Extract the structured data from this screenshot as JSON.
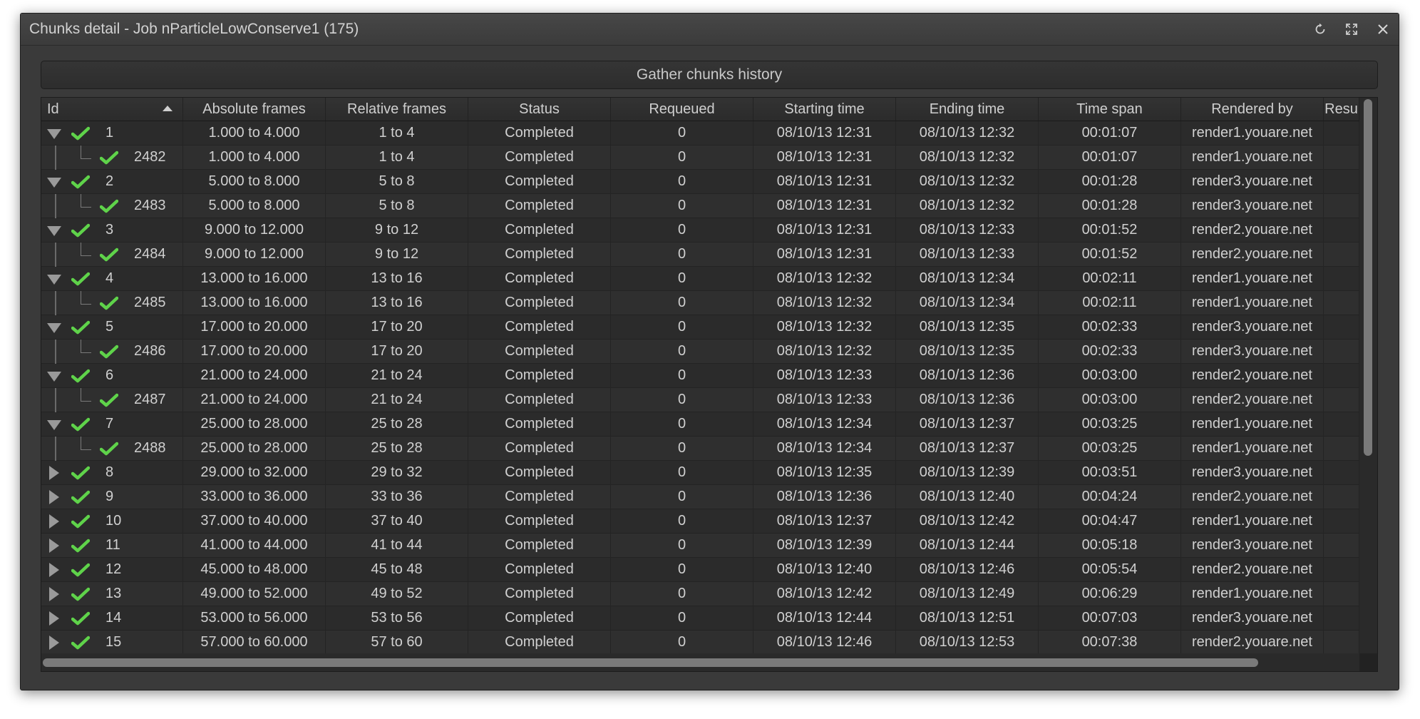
{
  "window": {
    "title": "Chunks detail - Job nParticleLowConserve1 (175)"
  },
  "toolbar": {
    "gather_label": "Gather chunks history"
  },
  "table": {
    "columns": [
      {
        "key": "id",
        "label": "Id",
        "width": 199
      },
      {
        "key": "abs",
        "label": "Absolute frames",
        "width": 200
      },
      {
        "key": "rel",
        "label": "Relative frames",
        "width": 200
      },
      {
        "key": "status",
        "label": "Status",
        "width": 200
      },
      {
        "key": "requeued",
        "label": "Requeued",
        "width": 200
      },
      {
        "key": "start",
        "label": "Starting time",
        "width": 200
      },
      {
        "key": "end",
        "label": "Ending time",
        "width": 200
      },
      {
        "key": "span",
        "label": "Time span",
        "width": 200
      },
      {
        "key": "by",
        "label": "Rendered by",
        "width": 200
      },
      {
        "key": "res",
        "label": "Resu",
        "width": 50
      }
    ],
    "sorted_column": "id",
    "rows": [
      {
        "level": 0,
        "expanded": true,
        "id": "1",
        "abs": "1.000 to 4.000",
        "rel": "1 to 4",
        "status": "Completed",
        "requeued": "0",
        "start": "08/10/13 12:31",
        "end": "08/10/13 12:32",
        "span": "00:01:07",
        "by": "render1.youare.net"
      },
      {
        "level": 1,
        "id": "2482",
        "abs": "1.000 to 4.000",
        "rel": "1 to 4",
        "status": "Completed",
        "requeued": "0",
        "start": "08/10/13 12:31",
        "end": "08/10/13 12:32",
        "span": "00:01:07",
        "by": "render1.youare.net"
      },
      {
        "level": 0,
        "expanded": true,
        "id": "2",
        "abs": "5.000 to 8.000",
        "rel": "5 to 8",
        "status": "Completed",
        "requeued": "0",
        "start": "08/10/13 12:31",
        "end": "08/10/13 12:32",
        "span": "00:01:28",
        "by": "render3.youare.net"
      },
      {
        "level": 1,
        "id": "2483",
        "abs": "5.000 to 8.000",
        "rel": "5 to 8",
        "status": "Completed",
        "requeued": "0",
        "start": "08/10/13 12:31",
        "end": "08/10/13 12:32",
        "span": "00:01:28",
        "by": "render3.youare.net"
      },
      {
        "level": 0,
        "expanded": true,
        "id": "3",
        "abs": "9.000 to 12.000",
        "rel": "9 to 12",
        "status": "Completed",
        "requeued": "0",
        "start": "08/10/13 12:31",
        "end": "08/10/13 12:33",
        "span": "00:01:52",
        "by": "render2.youare.net"
      },
      {
        "level": 1,
        "id": "2484",
        "abs": "9.000 to 12.000",
        "rel": "9 to 12",
        "status": "Completed",
        "requeued": "0",
        "start": "08/10/13 12:31",
        "end": "08/10/13 12:33",
        "span": "00:01:52",
        "by": "render2.youare.net"
      },
      {
        "level": 0,
        "expanded": true,
        "id": "4",
        "abs": "13.000 to 16.000",
        "rel": "13 to 16",
        "status": "Completed",
        "requeued": "0",
        "start": "08/10/13 12:32",
        "end": "08/10/13 12:34",
        "span": "00:02:11",
        "by": "render1.youare.net"
      },
      {
        "level": 1,
        "id": "2485",
        "abs": "13.000 to 16.000",
        "rel": "13 to 16",
        "status": "Completed",
        "requeued": "0",
        "start": "08/10/13 12:32",
        "end": "08/10/13 12:34",
        "span": "00:02:11",
        "by": "render1.youare.net"
      },
      {
        "level": 0,
        "expanded": true,
        "id": "5",
        "abs": "17.000 to 20.000",
        "rel": "17 to 20",
        "status": "Completed",
        "requeued": "0",
        "start": "08/10/13 12:32",
        "end": "08/10/13 12:35",
        "span": "00:02:33",
        "by": "render3.youare.net"
      },
      {
        "level": 1,
        "id": "2486",
        "abs": "17.000 to 20.000",
        "rel": "17 to 20",
        "status": "Completed",
        "requeued": "0",
        "start": "08/10/13 12:32",
        "end": "08/10/13 12:35",
        "span": "00:02:33",
        "by": "render3.youare.net"
      },
      {
        "level": 0,
        "expanded": true,
        "id": "6",
        "abs": "21.000 to 24.000",
        "rel": "21 to 24",
        "status": "Completed",
        "requeued": "0",
        "start": "08/10/13 12:33",
        "end": "08/10/13 12:36",
        "span": "00:03:00",
        "by": "render2.youare.net"
      },
      {
        "level": 1,
        "id": "2487",
        "abs": "21.000 to 24.000",
        "rel": "21 to 24",
        "status": "Completed",
        "requeued": "0",
        "start": "08/10/13 12:33",
        "end": "08/10/13 12:36",
        "span": "00:03:00",
        "by": "render2.youare.net"
      },
      {
        "level": 0,
        "expanded": true,
        "id": "7",
        "abs": "25.000 to 28.000",
        "rel": "25 to 28",
        "status": "Completed",
        "requeued": "0",
        "start": "08/10/13 12:34",
        "end": "08/10/13 12:37",
        "span": "00:03:25",
        "by": "render1.youare.net"
      },
      {
        "level": 1,
        "id": "2488",
        "abs": "25.000 to 28.000",
        "rel": "25 to 28",
        "status": "Completed",
        "requeued": "0",
        "start": "08/10/13 12:34",
        "end": "08/10/13 12:37",
        "span": "00:03:25",
        "by": "render1.youare.net"
      },
      {
        "level": 0,
        "expanded": false,
        "id": "8",
        "abs": "29.000 to 32.000",
        "rel": "29 to 32",
        "status": "Completed",
        "requeued": "0",
        "start": "08/10/13 12:35",
        "end": "08/10/13 12:39",
        "span": "00:03:51",
        "by": "render3.youare.net"
      },
      {
        "level": 0,
        "expanded": false,
        "id": "9",
        "abs": "33.000 to 36.000",
        "rel": "33 to 36",
        "status": "Completed",
        "requeued": "0",
        "start": "08/10/13 12:36",
        "end": "08/10/13 12:40",
        "span": "00:04:24",
        "by": "render2.youare.net"
      },
      {
        "level": 0,
        "expanded": false,
        "id": "10",
        "abs": "37.000 to 40.000",
        "rel": "37 to 40",
        "status": "Completed",
        "requeued": "0",
        "start": "08/10/13 12:37",
        "end": "08/10/13 12:42",
        "span": "00:04:47",
        "by": "render1.youare.net"
      },
      {
        "level": 0,
        "expanded": false,
        "id": "11",
        "abs": "41.000 to 44.000",
        "rel": "41 to 44",
        "status": "Completed",
        "requeued": "0",
        "start": "08/10/13 12:39",
        "end": "08/10/13 12:44",
        "span": "00:05:18",
        "by": "render3.youare.net"
      },
      {
        "level": 0,
        "expanded": false,
        "id": "12",
        "abs": "45.000 to 48.000",
        "rel": "45 to 48",
        "status": "Completed",
        "requeued": "0",
        "start": "08/10/13 12:40",
        "end": "08/10/13 12:46",
        "span": "00:05:54",
        "by": "render2.youare.net"
      },
      {
        "level": 0,
        "expanded": false,
        "id": "13",
        "abs": "49.000 to 52.000",
        "rel": "49 to 52",
        "status": "Completed",
        "requeued": "0",
        "start": "08/10/13 12:42",
        "end": "08/10/13 12:49",
        "span": "00:06:29",
        "by": "render1.youare.net"
      },
      {
        "level": 0,
        "expanded": false,
        "id": "14",
        "abs": "53.000 to 56.000",
        "rel": "53 to 56",
        "status": "Completed",
        "requeued": "0",
        "start": "08/10/13 12:44",
        "end": "08/10/13 12:51",
        "span": "00:07:03",
        "by": "render3.youare.net"
      },
      {
        "level": 0,
        "expanded": false,
        "id": "15",
        "abs": "57.000 to 60.000",
        "rel": "57 to 60",
        "status": "Completed",
        "requeued": "0",
        "start": "08/10/13 12:46",
        "end": "08/10/13 12:53",
        "span": "00:07:38",
        "by": "render2.youare.net"
      }
    ]
  },
  "colors": {
    "check_green": "#5fd34a",
    "background": "#2b2b2b",
    "text": "#d0d0d0"
  },
  "icons": {
    "refresh": "refresh-icon",
    "maximize": "maximize-icon",
    "close": "close-icon",
    "status": "check-icon"
  }
}
